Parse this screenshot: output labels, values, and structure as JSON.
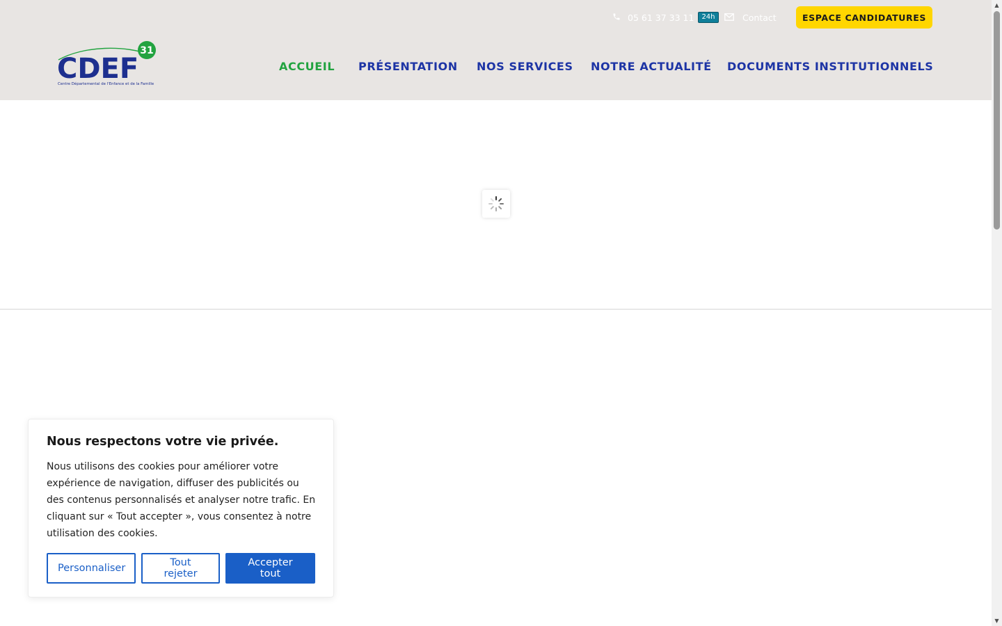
{
  "header": {
    "phone": "05 61 37 33 11",
    "phone_badge": "24h",
    "contact": "Contact",
    "cta": "ESPACE CANDIDATURES",
    "logo_text": "CDEF",
    "logo_number": "31",
    "logo_tagline": "Centre Départemental de l'Enfance et de la Famille"
  },
  "nav": {
    "items": [
      {
        "label": "ACCUEIL"
      },
      {
        "label": "PRÉSENTATION"
      },
      {
        "label": "NOS SERVICES"
      },
      {
        "label": "NOTRE ACTUALITÉ"
      },
      {
        "label": "DOCUMENTS INSTITUTIONNELS"
      }
    ]
  },
  "cookie": {
    "title": "Nous respectons votre vie privée.",
    "text": "Nous utilisons des cookies pour améliorer votre expérience de navigation, diffuser des publicités ou des contenus personnalisés et analyser notre trafic. En cliquant sur « Tout accepter », vous consentez à notre utilisation des cookies.",
    "customize": "Personnaliser",
    "reject": "Tout rejeter",
    "accept": "Accepter tout"
  },
  "colors": {
    "header_bg": "#e8e5e3",
    "nav_blue": "#1d34a5",
    "nav_active_green": "#22a340",
    "cta_yellow": "#ffd600",
    "cookie_blue": "#1a5fc7"
  },
  "icons": [
    "phone-icon",
    "mail-icon",
    "loading-spinner-icon",
    "chevron-up-icon",
    "chevron-down-icon"
  ]
}
